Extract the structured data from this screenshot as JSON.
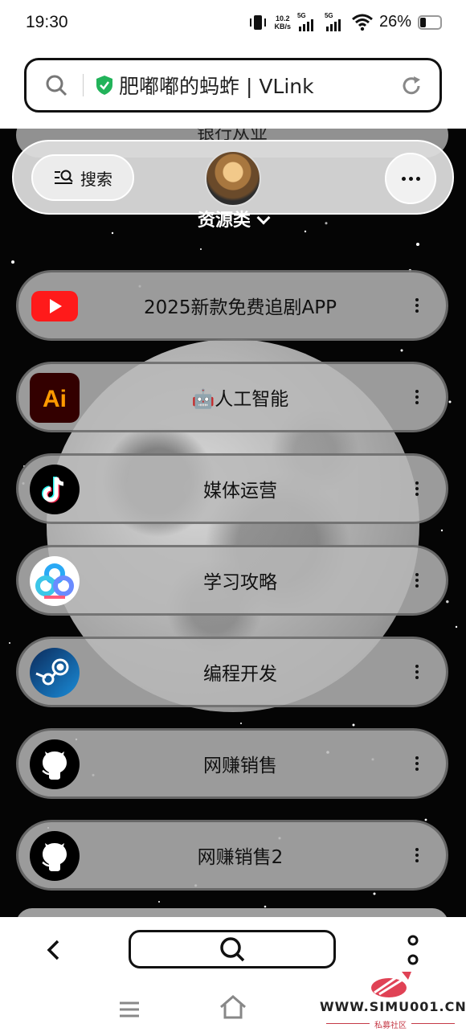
{
  "status_bar": {
    "time": "19:30",
    "net_speed_value": "10.2",
    "net_speed_unit": "KB/s",
    "sim1_tag": "5G",
    "sim2_tag": "5G",
    "battery_percent": "26%"
  },
  "url_bar": {
    "site_title": "肥嘟嘟的蚂蚱 | VLink",
    "secure_color": "#22b35a"
  },
  "page": {
    "top_partial_label": "银行从业",
    "search_label": "搜索",
    "section_title": "资源类",
    "links": [
      {
        "label": "2025新款免费追剧APP",
        "icon": "youtube-icon"
      },
      {
        "label": "🤖人工智能",
        "icon": "adobe-illustrator-icon"
      },
      {
        "label": "媒体运营",
        "icon": "tiktok-icon"
      },
      {
        "label": "学习攻略",
        "icon": "baidu-netdisk-icon"
      },
      {
        "label": "编程开发",
        "icon": "steam-icon"
      },
      {
        "label": "网赚销售",
        "icon": "github-icon"
      },
      {
        "label": "网赚销售2",
        "icon": "github-icon"
      }
    ]
  },
  "watermark": {
    "domain": "WWW.SIMU001.CN",
    "subtitle": "私募社区"
  }
}
